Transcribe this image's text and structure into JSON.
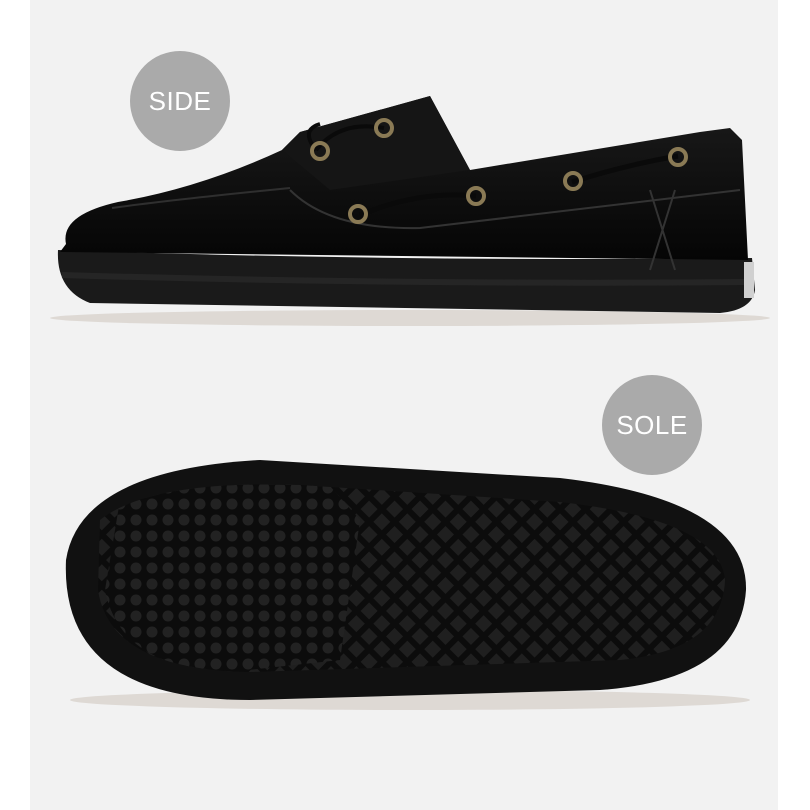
{
  "labels": {
    "side": "SIDE",
    "sole": "SOLE"
  },
  "colors": {
    "background": "#f2f2f2",
    "badge": "#aaaaaa",
    "badge_text": "#ffffff",
    "shoe": "#111111",
    "eyelet": "#8a7a55"
  }
}
